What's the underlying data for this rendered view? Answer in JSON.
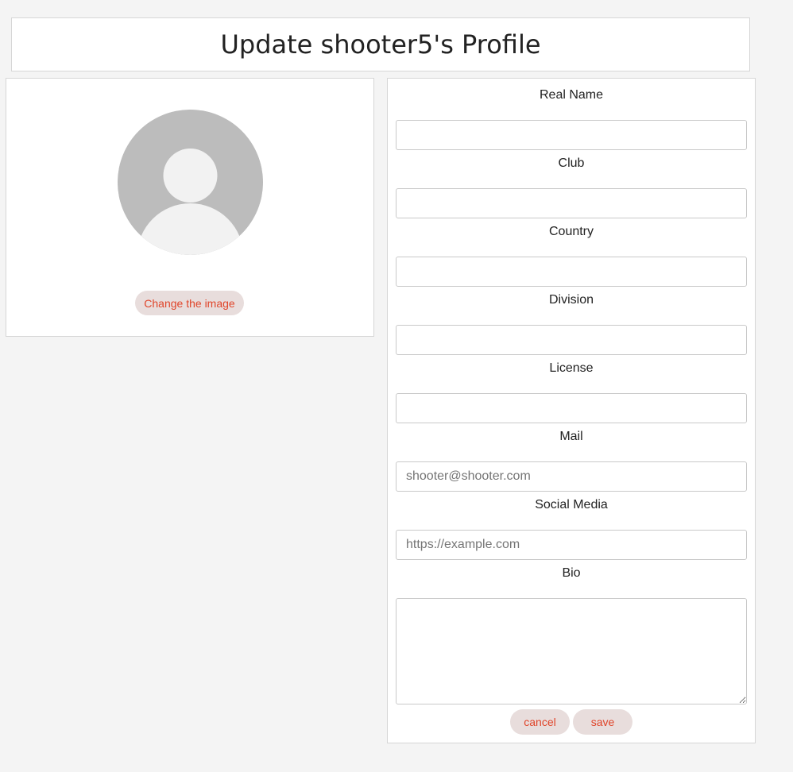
{
  "header": {
    "title": "Update shooter5's Profile"
  },
  "avatar_card": {
    "avatar_icon": "default-user-avatar",
    "change_image_label": "Change the image"
  },
  "form": {
    "fields": [
      {
        "label": "Real Name",
        "value": "",
        "placeholder": ""
      },
      {
        "label": "Club",
        "value": "",
        "placeholder": ""
      },
      {
        "label": "Country",
        "value": "",
        "placeholder": ""
      },
      {
        "label": "Division",
        "value": "",
        "placeholder": ""
      },
      {
        "label": "License",
        "value": "",
        "placeholder": ""
      },
      {
        "label": "Mail",
        "value": "",
        "placeholder": "shooter@shooter.com"
      },
      {
        "label": "Social Media",
        "value": "",
        "placeholder": "https://example.com"
      }
    ],
    "bio": {
      "label": "Bio",
      "value": ""
    },
    "cancel_label": "cancel",
    "save_label": "save"
  },
  "colors": {
    "background": "#f4f4f4",
    "accent_text": "#e0452a",
    "button_bg": "#e8dddc",
    "avatar_bg": "#bcbcbc",
    "avatar_fg": "#f2f2f2"
  }
}
